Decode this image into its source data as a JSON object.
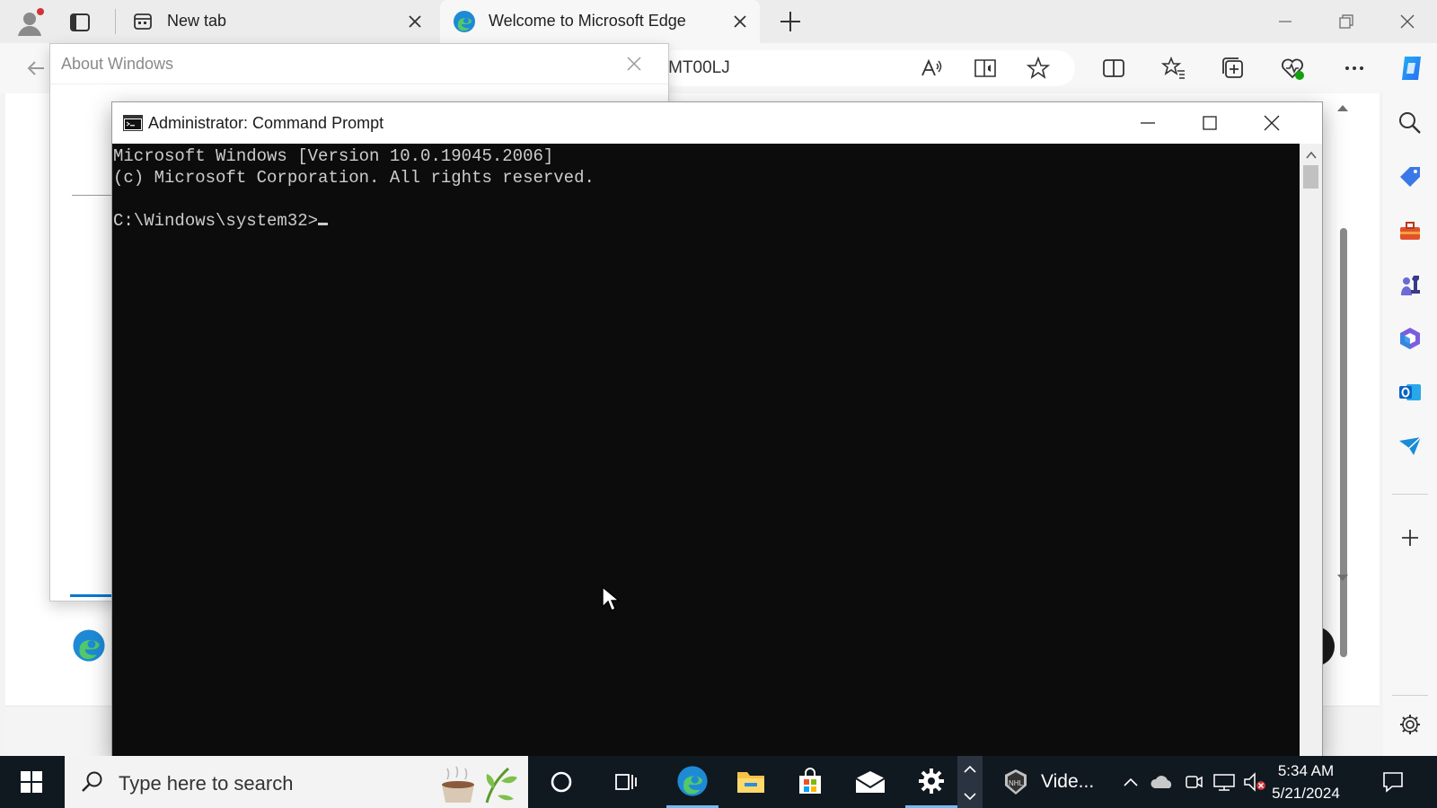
{
  "browser": {
    "tabs": [
      {
        "title": "New tab",
        "icon": "newtab-icon"
      },
      {
        "title": "Welcome to Microsoft Edge",
        "icon": "edge-icon",
        "active": true
      }
    ],
    "address_partial": "=MT00LJ",
    "accent": "#0078d4"
  },
  "about_dialog": {
    "title": "About Windows"
  },
  "cmd": {
    "title": "Administrator: Command Prompt",
    "line1": "Microsoft Windows [Version 10.0.19045.2006]",
    "line2": "(c) Microsoft Corporation. All rights reserved.",
    "prompt": "C:\\Windows\\system32>"
  },
  "taskbar": {
    "search_placeholder": "Type here to search",
    "video_label": "Vide...",
    "time": "5:34 AM",
    "date": "5/21/2024",
    "bg": "#101820"
  }
}
